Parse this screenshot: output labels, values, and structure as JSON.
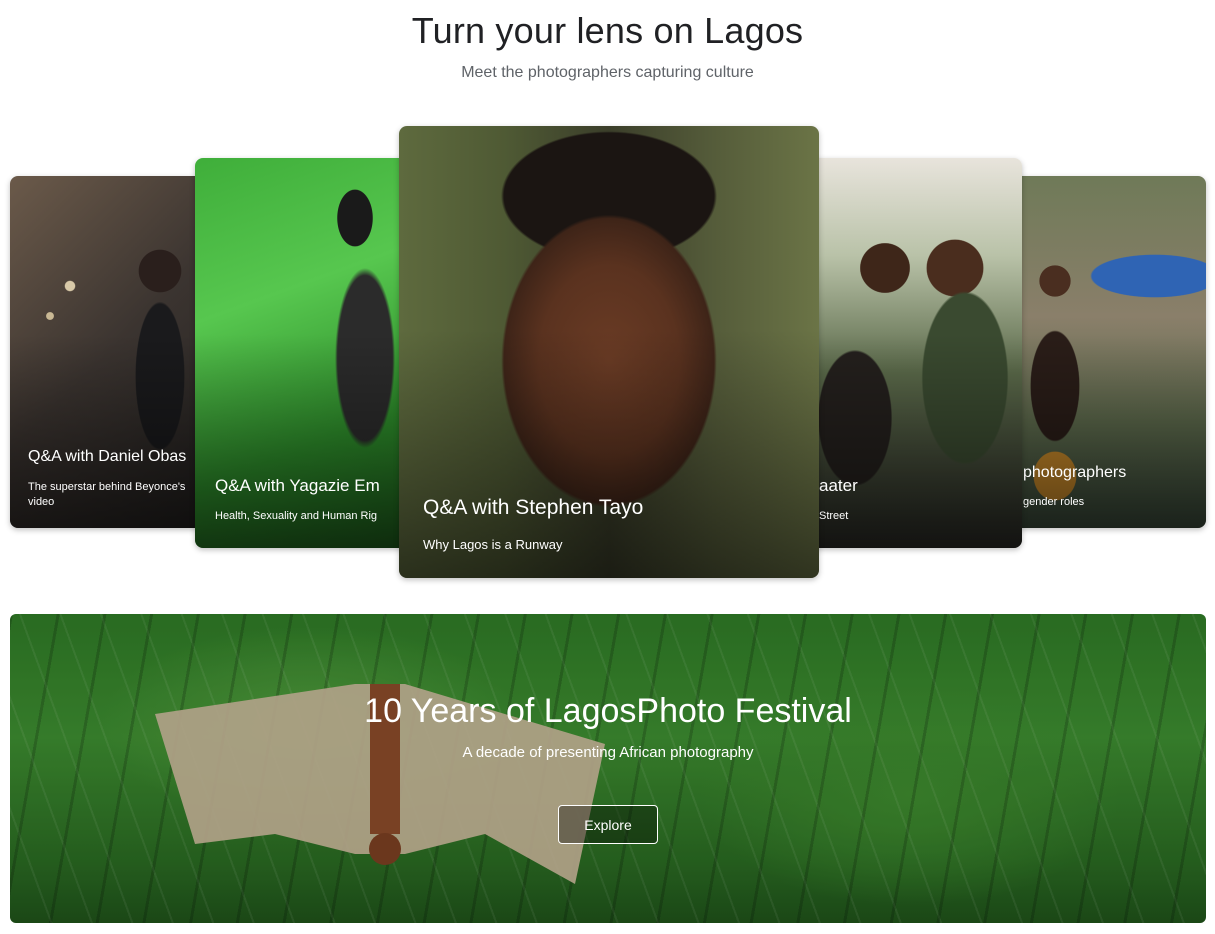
{
  "header": {
    "title": "Turn your lens on Lagos",
    "subtitle": "Meet the photographers capturing culture"
  },
  "carousel": {
    "cards": [
      {
        "title": "Q&A with Daniel Obas",
        "subtitle": "The superstar behind Beyonce's video"
      },
      {
        "title": "Q&A with Yagazie Em",
        "subtitle": "Health, Sexuality and Human Rig"
      },
      {
        "title": "Q&A with Stephen Tayo",
        "subtitle": "Why Lagos is a Runway"
      },
      {
        "title": "aater",
        "subtitle": "Street"
      },
      {
        "title": "photographers",
        "subtitle": "gender roles"
      }
    ]
  },
  "banner": {
    "title": "10 Years of LagosPhoto Festival",
    "subtitle": "A decade of presenting African photography",
    "button_label": "Explore"
  }
}
